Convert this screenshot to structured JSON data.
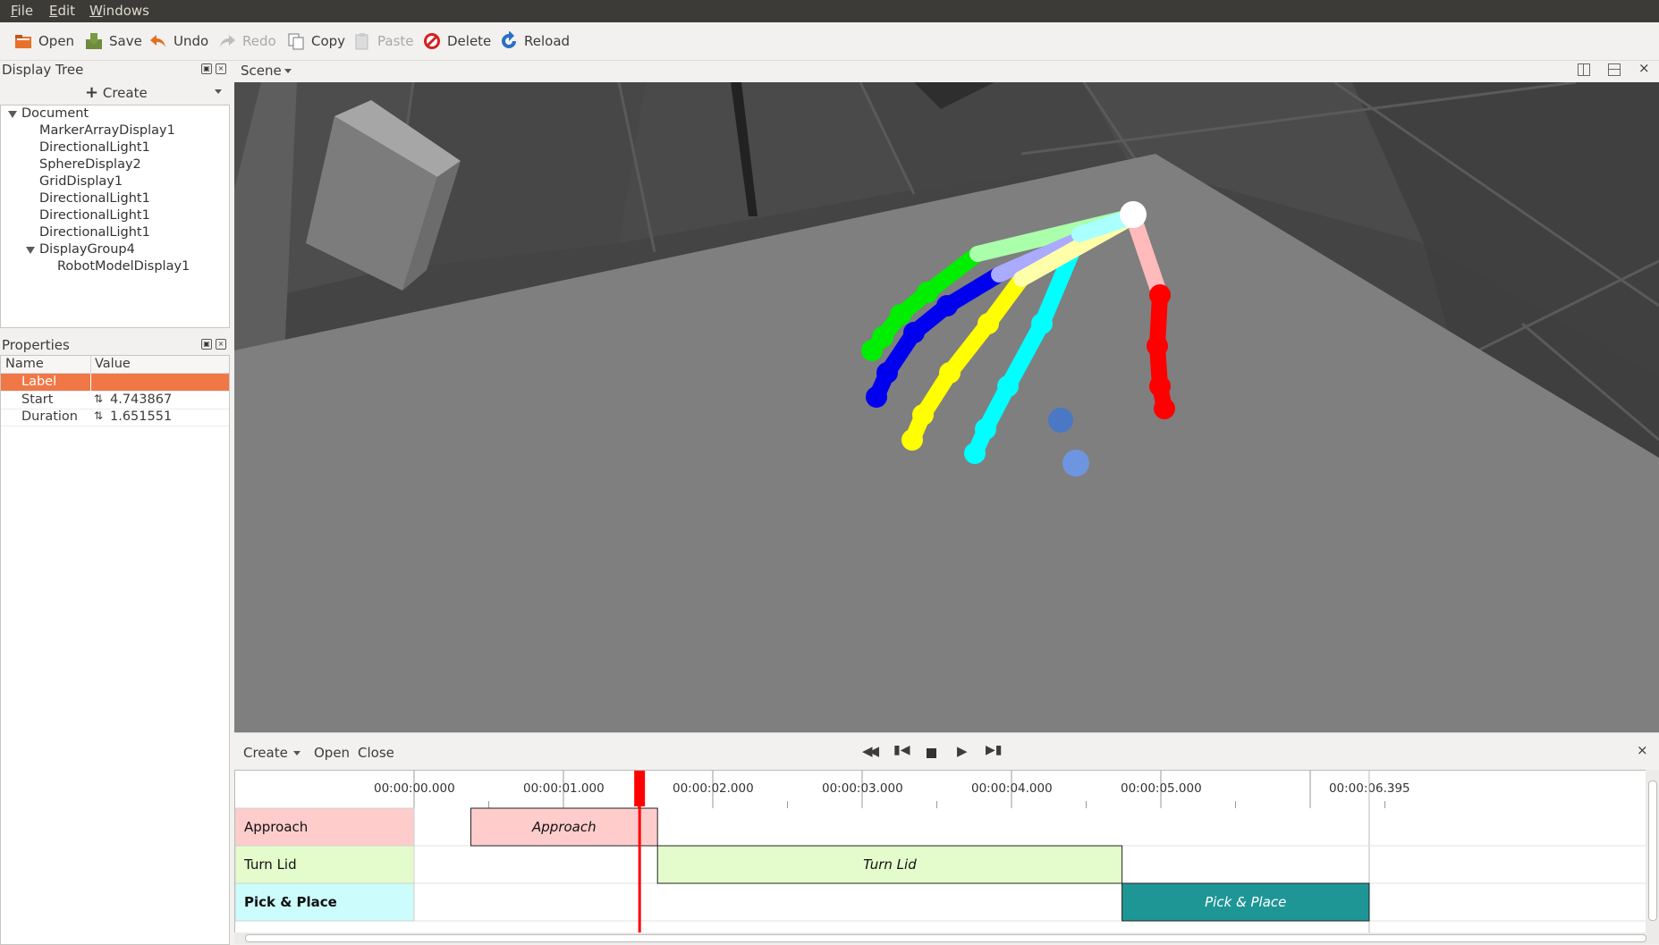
{
  "menu": [
    "File",
    "Edit",
    "Windows"
  ],
  "toolbar": {
    "open": "Open",
    "save": "Save",
    "undo": "Undo",
    "redo": "Redo",
    "copy": "Copy",
    "paste": "Paste",
    "delete": "Delete",
    "reload": "Reload"
  },
  "display_tree": {
    "title": "Display Tree",
    "create_label": "Create",
    "root": "Document",
    "items": [
      "MarkerArrayDisplay1",
      "DirectionalLight1",
      "SphereDisplay2",
      "GridDisplay1",
      "DirectionalLight1",
      "DirectionalLight1",
      "DirectionalLight1"
    ],
    "group": "DisplayGroup4",
    "group_child": "RobotModelDisplay1"
  },
  "properties": {
    "title": "Properties",
    "col_name": "Name",
    "col_value": "Value",
    "rows": [
      {
        "name": "Label",
        "value": ""
      },
      {
        "name": "Start",
        "value": "4.743867"
      },
      {
        "name": "Duration",
        "value": "1.651551"
      }
    ]
  },
  "scene": {
    "title": "Scene"
  },
  "timeline": {
    "create": "Create",
    "open": "Open",
    "close": "Close",
    "ticks": [
      "00:00:00.000",
      "00:00:01.000",
      "00:00:02.000",
      "00:00:03.000",
      "00:00:04.000",
      "00:00:05.000",
      "00:00:06.395"
    ],
    "cursor_time": 1.51,
    "tracks": [
      {
        "label": "Approach",
        "bold": false,
        "label_color": "#ffcccc",
        "clip": {
          "label": "Approach",
          "start": 0.38,
          "end": 1.63,
          "color": "#ffcccc"
        }
      },
      {
        "label": "Turn Lid",
        "bold": false,
        "label_color": "#e4fccc",
        "clip": {
          "label": "Turn Lid",
          "start": 1.63,
          "end": 4.74,
          "color": "#e4fccc"
        }
      },
      {
        "label": "Pick & Place",
        "bold": true,
        "label_color": "#ccfcfc",
        "clip": {
          "label": "Pick & Place",
          "start": 4.74,
          "end": 6.395,
          "color": "#1f9696"
        }
      }
    ]
  },
  "colors": {
    "selection": "#f07746",
    "cursor": "#ff0000",
    "menubar": "#3c3b37"
  }
}
